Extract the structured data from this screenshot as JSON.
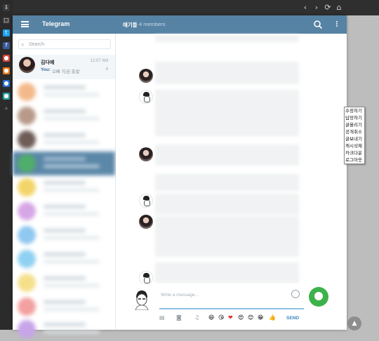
{
  "browser": {
    "nav": [
      "‹",
      "›",
      "⟳",
      "⌂"
    ]
  },
  "rail": {
    "icons": [
      {
        "name": "download-icon",
        "glyph": "⇩"
      },
      {
        "name": "extension-icon",
        "glyph": "□"
      },
      {
        "name": "twitter-icon",
        "glyph": "t"
      },
      {
        "name": "facebook-icon",
        "glyph": "f"
      },
      {
        "name": "app-red-icon",
        "glyph": "●"
      },
      {
        "name": "app-orange-icon",
        "glyph": "●"
      },
      {
        "name": "app-blue-icon",
        "glyph": "●"
      },
      {
        "name": "app-green-icon",
        "glyph": "●"
      },
      {
        "name": "add-icon",
        "glyph": "+"
      }
    ]
  },
  "app": {
    "title": "Telegram",
    "chat_title": "애기들",
    "members": "4 members"
  },
  "sidebar": {
    "search_placeholder": "Search",
    "conversation": {
      "name": "김다예",
      "time": "12:07 AM",
      "you_prefix": "You:",
      "preview": "오빠 지금 출발",
      "badge": "4"
    }
  },
  "composer": {
    "placeholder": "Write a message...",
    "send_label": "SEND",
    "emojis": [
      "😆",
      "😘",
      "❤",
      "😍",
      "😊",
      "😁",
      "👍"
    ]
  },
  "context_menu": {
    "items": [
      "수정하기",
      "답장하기",
      "글올리기",
      "공개취소",
      "글보내기",
      "캐시삭제",
      "카크다운",
      "로그아웃"
    ]
  },
  "colors": {
    "header": "#5682a3",
    "accent": "#3a86c6"
  }
}
